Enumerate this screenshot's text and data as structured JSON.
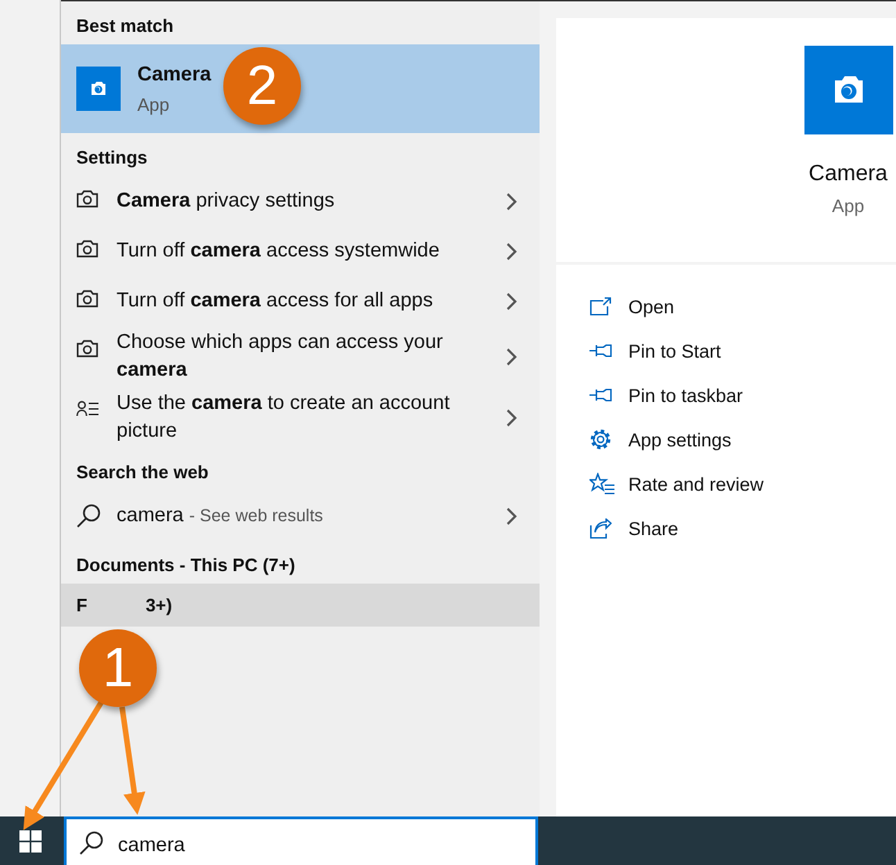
{
  "best_match": {
    "heading": "Best match",
    "name": "Camera",
    "type": "App",
    "selected": true
  },
  "settings": {
    "heading": "Settings",
    "items": [
      {
        "kind": "camera",
        "text": "**Camera** privacy settings"
      },
      {
        "kind": "camera",
        "text": "Turn off **camera** access systemwide"
      },
      {
        "kind": "camera",
        "text": "Turn off **camera** access for all apps"
      },
      {
        "kind": "camera",
        "text": "Choose which apps can access your **camera**"
      },
      {
        "kind": "account",
        "text": "Use the **camera** to create an account picture"
      }
    ]
  },
  "web": {
    "heading": "Search the web",
    "query": "camera",
    "hint": "- See web results"
  },
  "documents": {
    "heading": "Documents - This PC (7+)"
  },
  "folders": {
    "parts": [
      "F",
      "3+)"
    ]
  },
  "preview": {
    "name": "Camera",
    "type": "App",
    "actions": [
      {
        "kind": "open",
        "label": "Open"
      },
      {
        "kind": "pin",
        "label": "Pin to Start"
      },
      {
        "kind": "pin",
        "label": "Pin to taskbar"
      },
      {
        "kind": "settings",
        "label": "App settings"
      },
      {
        "kind": "rate",
        "label": "Rate and review"
      },
      {
        "kind": "share",
        "label": "Share"
      }
    ]
  },
  "taskbar": {
    "search": {
      "value": "camera"
    }
  },
  "callouts": [
    {
      "label": "1"
    },
    {
      "label": "2"
    }
  ]
}
